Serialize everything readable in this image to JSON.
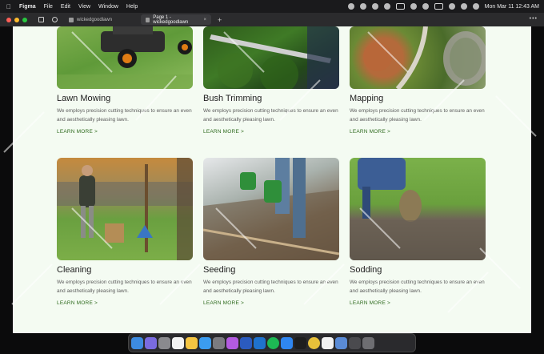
{
  "menubar": {
    "app": "Figma",
    "menus": [
      "File",
      "Edit",
      "View",
      "Window",
      "Help"
    ],
    "battery_label": "",
    "datetime": "Mon Mar 11  12:43 AM"
  },
  "tabs": [
    {
      "label": "wickedgoodlawn"
    },
    {
      "label": "Page 1 - wickedgoodlawn",
      "close": "×"
    }
  ],
  "tab_plus": "+",
  "tab_more": "•••",
  "services": [
    {
      "title": "Lawn Mowing",
      "description": "We employs precision cutting techniques to ensure an even and aesthetically pleasing lawn.",
      "link": "LEARN MORE >"
    },
    {
      "title": "Bush Trimming",
      "description": "We employs precision cutting techniques to ensure an even and aesthetically pleasing lawn.",
      "link": "LEARN MORE >"
    },
    {
      "title": "Mapping",
      "description": "We employs precision cutting techniques to ensure an even and aesthetically pleasing lawn.",
      "link": "LEARN MORE >"
    },
    {
      "title": "Cleaning",
      "description": "We employs precision cutting techniques to ensure an even and aesthetically pleasing lawn.",
      "link": "LEARN MORE >"
    },
    {
      "title": "Seeding",
      "description": "We employs precision cutting techniques to ensure an even and aesthetically pleasing lawn.",
      "link": "LEARN MORE >"
    },
    {
      "title": "Sodding",
      "description": "We employs precision cutting techniques to ensure an even and aesthetically pleasing lawn.",
      "link": "LEARN MORE >"
    }
  ],
  "colors": {
    "page_bg": "#f4fbf2",
    "link": "#2f6b1f",
    "heading": "#1d1d1d"
  },
  "dock_icons": [
    "finder-icon",
    "launchpad-icon",
    "photos-icon",
    "calendar-icon",
    "notes-icon",
    "safari-icon",
    "settings-icon",
    "podcasts-icon",
    "word-icon",
    "outlook-icon",
    "spotify-icon",
    "appstore-icon",
    "figma-icon",
    "chrome-icon",
    "calendar2-icon",
    "preview-icon",
    "files-icon",
    "trash-icon"
  ]
}
